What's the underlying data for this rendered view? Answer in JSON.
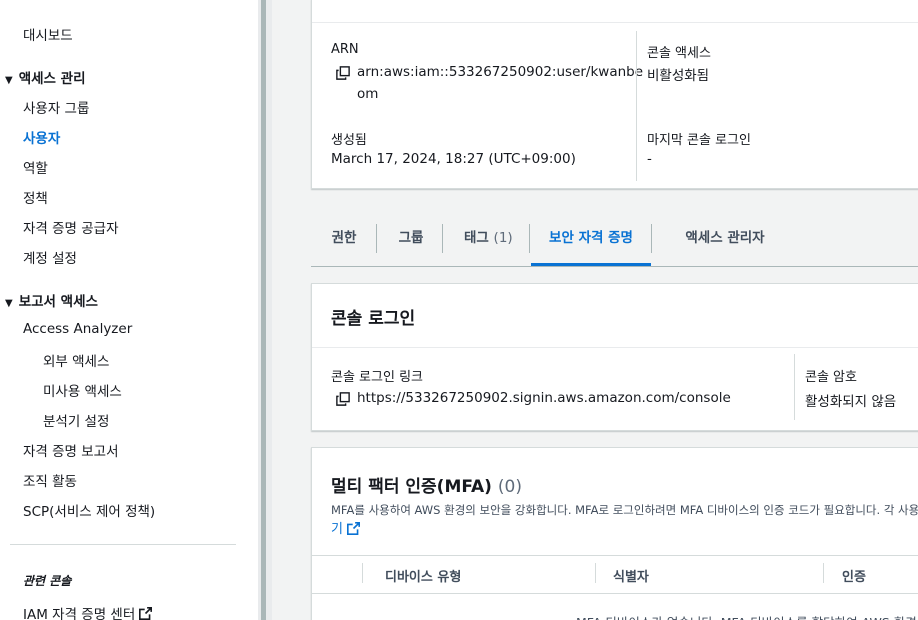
{
  "sidebar": {
    "dashboard": "대시보드",
    "access_management": "액세스 관리",
    "user_groups": "사용자 그룹",
    "users": "사용자",
    "roles": "역할",
    "policies": "정책",
    "identity_providers": "자격 증명 공급자",
    "account_settings": "계정 설정",
    "access_reports": "보고서 액세스",
    "access_analyzer": "Access Analyzer",
    "external_access": "외부 액세스",
    "unused_access": "미사용 액세스",
    "analyzer_settings": "분석기 설정",
    "credential_report": "자격 증명 보고서",
    "org_activity": "조직 활동",
    "scp": "SCP(서비스 제어 정책)",
    "related_consoles": "관련 콘솔",
    "iam_identity_center": "IAM 자격 증명 센터"
  },
  "summary": {
    "arn_label": "ARN",
    "arn_line1": "arn:aws:iam::533267250902:user/kwanbe",
    "arn_line2": "om",
    "console_access_label": "콘솔 액세스",
    "console_access_value": "비활성화됨",
    "created_label": "생성됨",
    "created_value": "March 17, 2024, 18:27 (UTC+09:00)",
    "last_login_label": "마지막 콘솔 로그인",
    "last_login_value": "-"
  },
  "tabs": {
    "permissions": "권한",
    "groups": "그룹",
    "tags": "태그",
    "tags_count": "(1)",
    "security_credentials": "보안 자격 증명",
    "access_advisor": "액세스 관리자"
  },
  "console_login": {
    "title": "콘솔 로그인",
    "link_label": "콘솔 로그인 링크",
    "link_value": "https://533267250902.signin.aws.amazon.com/console",
    "password_label": "콘솔 암호",
    "password_value": "활성화되지 않음"
  },
  "mfa": {
    "title": "멀티 팩터 인증(MFA)",
    "count": "(0)",
    "description": "MFA를 사용하여 AWS 환경의 보안을 강화합니다. MFA로 로그인하려면 MFA 디바이스의 인증 코드가 필요합니다. 각 사용자는",
    "link_fragment": "기",
    "columns": [
      "디바이스 유형",
      "식별자",
      "인증"
    ],
    "empty_message": "MFA 디바이스가 없습니다. MFA 디바이스를 할당하여 AWS 환경"
  },
  "colors": {
    "accent": "#0972d3",
    "text": "#16191f",
    "border": "#d5dbdb",
    "background": "#f2f3f3"
  }
}
